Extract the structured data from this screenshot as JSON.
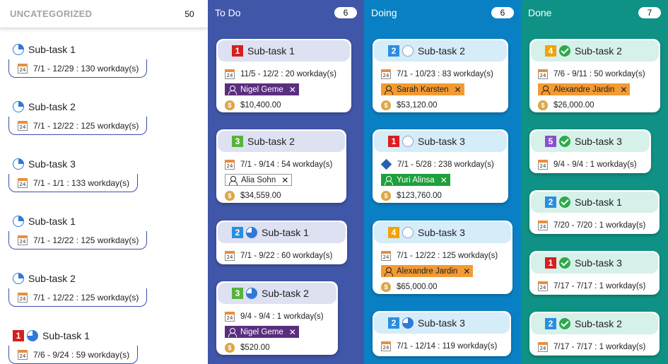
{
  "columns": {
    "uncategorized": {
      "title": "UNCATEGORIZED",
      "count": "50",
      "items": [
        {
          "title": "Sub-task 1",
          "dates": "7/1 - 12/29 : 130 workday(s)",
          "status": "quarter"
        },
        {
          "title": "Sub-task 2",
          "dates": "7/1 - 12/22 : 125 workday(s)",
          "status": "quarter"
        },
        {
          "title": "Sub-task 3",
          "dates": "7/1 - 1/1 : 133 workday(s)",
          "status": "quarter"
        },
        {
          "title": "Sub-task 1",
          "dates": "7/1 - 12/22 : 125 workday(s)",
          "status": "quarter"
        },
        {
          "title": "Sub-task 2",
          "dates": "7/1 - 12/22 : 125 workday(s)",
          "status": "quarter"
        },
        {
          "title": "Sub-task 1",
          "dates": "7/6 - 9/24 : 59 workday(s)",
          "priority": "1",
          "status": "three-quarter"
        }
      ]
    },
    "todo": {
      "title": "To Do",
      "count": "6",
      "cards": [
        {
          "priority": "1",
          "title": "Sub-task 1",
          "dates": "11/5 - 12/2 : 20 workday(s)",
          "assignee": "Nigel Geme",
          "amount": "$10,400.00"
        },
        {
          "priority": "3",
          "title": "Sub-task 2",
          "dates": "7/1 - 9/14 : 54 workday(s)",
          "assignee": "Alia Sohn",
          "amount": "$34,559.00"
        },
        {
          "priority": "2",
          "title": "Sub-task 1",
          "dates": "7/1 - 9/22 : 60 workday(s)",
          "status": "three-quarter"
        },
        {
          "priority": "3",
          "title": "Sub-task 2",
          "dates": "9/4 - 9/4 : 1 workday(s)",
          "assignee": "Nigel Geme",
          "amount": "$520.00",
          "status": "three-quarter"
        }
      ]
    },
    "doing": {
      "title": "Doing",
      "count": "6",
      "cards": [
        {
          "priority": "2",
          "title": "Sub-task 2",
          "dates": "7/1 - 10/23 : 83 workday(s)",
          "assignee": "Sarah Karsten",
          "amount": "$53,120.00",
          "status": "empty"
        },
        {
          "priority": "1",
          "title": "Sub-task 3",
          "dates": "7/1 - 5/28 : 238 workday(s)",
          "assignee": "Yuri Alinsa",
          "amount": "$123,760.00",
          "status": "empty"
        },
        {
          "priority": "4",
          "title": "Sub-task 3",
          "dates": "7/1 - 12/22 : 125 workday(s)",
          "assignee": "Alexandre Jardin",
          "amount": "$65,000.00",
          "status": "empty"
        },
        {
          "priority": "2",
          "title": "Sub-task 3",
          "dates": "7/1 - 12/14 : 119 workday(s)",
          "status": "three-quarter"
        }
      ]
    },
    "done": {
      "title": "Done",
      "count": "7",
      "cards": [
        {
          "priority": "4",
          "title": "Sub-task 2",
          "dates": "7/6 - 9/11 : 50 workday(s)",
          "assignee": "Alexandre Jardin",
          "amount": "$26,000.00",
          "status": "done"
        },
        {
          "priority": "5",
          "title": "Sub-task 3",
          "dates": "9/4 - 9/4 : 1 workday(s)",
          "status": "done"
        },
        {
          "priority": "2",
          "title": "Sub-task 1",
          "dates": "7/20 - 7/20 : 1 workday(s)",
          "status": "done"
        },
        {
          "priority": "1",
          "title": "Sub-task 3",
          "dates": "7/17 - 7/17 : 1 workday(s)",
          "status": "done"
        },
        {
          "priority": "2",
          "title": "Sub-task 2",
          "dates": "7/17 - 7/17 : 1 workday(s)",
          "status": "done"
        }
      ]
    }
  },
  "colors": {
    "todo_column": "#4056a8",
    "doing_column": "#0a80c4",
    "done_column": "#0f9285",
    "priority_1": "#d71f1f",
    "priority_2": "#2a8ee0",
    "priority_3": "#58b33d",
    "priority_4": "#f0a30a",
    "priority_5": "#8a4fd1"
  },
  "icons": {
    "calendar": "calendar-icon",
    "money": "money-bag-icon",
    "dependency": "diamond-icon",
    "remove": "close-icon",
    "person": "person-icon",
    "done": "check-circle-icon"
  }
}
